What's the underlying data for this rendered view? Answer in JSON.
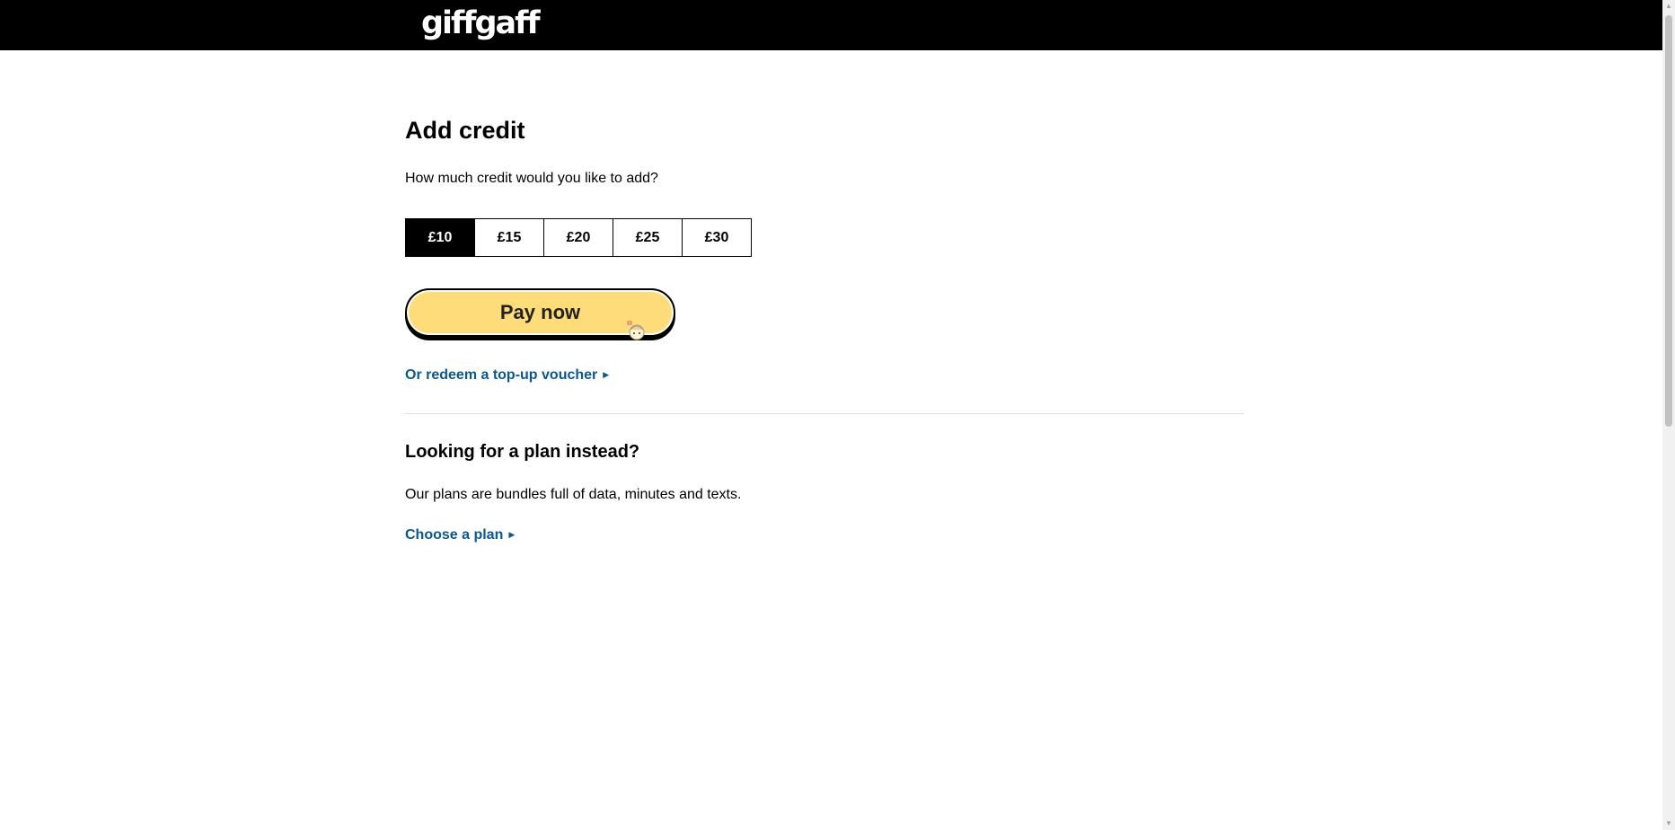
{
  "header": {
    "logo_text": "giffgaff"
  },
  "main": {
    "title": "Add credit",
    "prompt": "How much credit would you like to add?",
    "amounts": [
      {
        "label": "£10",
        "selected": true
      },
      {
        "label": "£15",
        "selected": false
      },
      {
        "label": "£20",
        "selected": false
      },
      {
        "label": "£25",
        "selected": false
      },
      {
        "label": "£30",
        "selected": false
      }
    ],
    "pay_label": "Pay now",
    "voucher_link": "Or redeem a top-up voucher"
  },
  "plans": {
    "title": "Looking for a plan instead?",
    "description": "Our plans are bundles full of data, minutes and texts.",
    "link": "Choose a plan"
  },
  "colors": {
    "header_bg": "#000000",
    "pay_button": "#ffdc7a",
    "link": "#0a5891",
    "selected_amount_bg": "#000000"
  }
}
